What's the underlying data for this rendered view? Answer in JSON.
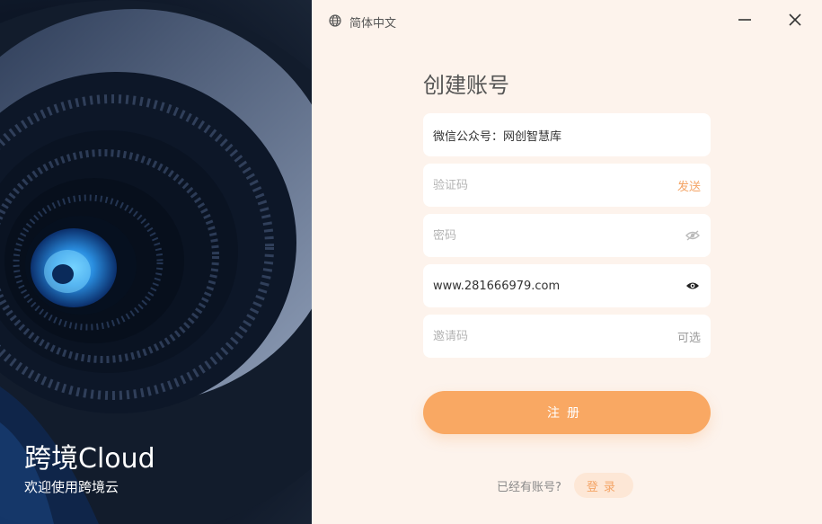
{
  "brand": {
    "title": "跨境Cloud",
    "subtitle": "欢迎使用跨境云"
  },
  "header": {
    "language": "简体中文",
    "icons": {
      "language": "globe-icon",
      "minimize": "minimize-icon",
      "close": "close-icon"
    }
  },
  "form": {
    "title": "创建账号",
    "account": {
      "value": "微信公众号：网创智慧库",
      "placeholder": ""
    },
    "code": {
      "placeholder": "验证码",
      "action": "发送"
    },
    "password": {
      "placeholder": "密码",
      "icon": "eye-off-icon"
    },
    "confirm": {
      "value": "www.281666979.com",
      "icon": "eye-icon"
    },
    "invite": {
      "placeholder": "邀请码",
      "hint": "可选"
    },
    "submit_label": "注册",
    "login_hint": "已经有账号?",
    "login_label": "登录"
  },
  "colors": {
    "accent": "#f9a863",
    "panel_bg": "#fdf3ec"
  }
}
